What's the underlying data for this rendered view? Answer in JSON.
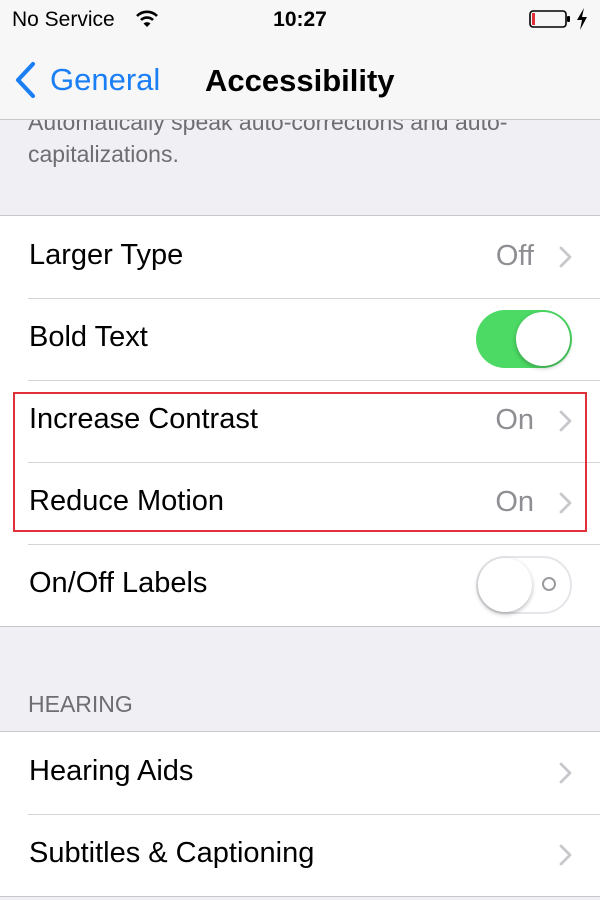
{
  "status_bar": {
    "carrier": "No Service",
    "time": "10:27",
    "battery_level": 0.1,
    "battery_color": "#e0303a"
  },
  "nav": {
    "back_label": "General",
    "title": "Accessibility"
  },
  "footer_note": "Automatically speak auto-corrections and auto-capitalizations.",
  "group_vision": {
    "rows": [
      {
        "label": "Larger Type",
        "value": "Off",
        "control": "disclosure"
      },
      {
        "label": "Bold Text",
        "control": "switch",
        "state": "on"
      },
      {
        "label": "Increase Contrast",
        "value": "On",
        "control": "disclosure",
        "highlighted": true
      },
      {
        "label": "Reduce Motion",
        "value": "On",
        "control": "disclosure",
        "highlighted": true
      },
      {
        "label": "On/Off Labels",
        "control": "switch",
        "state": "off"
      }
    ]
  },
  "hearing": {
    "header": "HEARING",
    "rows": [
      {
        "label": "Hearing Aids",
        "control": "disclosure"
      },
      {
        "label": "Subtitles & Captioning",
        "control": "disclosure"
      }
    ]
  },
  "colors": {
    "accent": "#1a7ef5",
    "switch_on": "#4cd964",
    "highlight": "#e0303a",
    "background": "#efeff4"
  },
  "icons": [
    "wifi-icon",
    "battery-icon",
    "charging-icon",
    "back-chevron-icon",
    "chevron-right-icon"
  ]
}
